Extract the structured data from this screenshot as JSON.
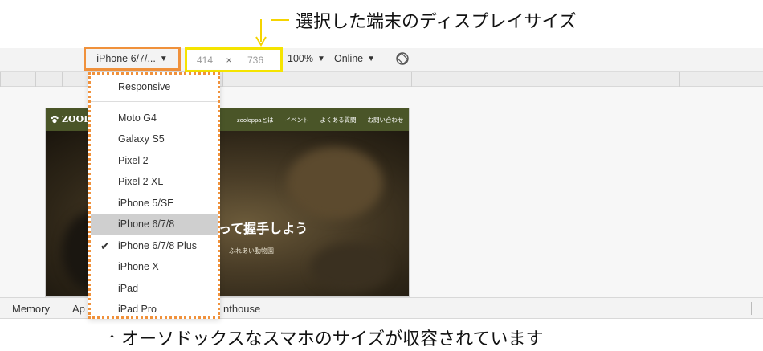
{
  "annotations": {
    "top_text": "選択した端末のディスプレイサイズ",
    "bottom_text": "↑ オーソドックスなスマホのサイズが収容されています"
  },
  "toolbar": {
    "device_label": "iPhone 6/7/...",
    "width_value": "414",
    "times_sign": "×",
    "height_value": "736",
    "zoom_label": "100%",
    "throttle_label": "Online",
    "caret": "▼"
  },
  "menu": {
    "items": [
      {
        "label": "Responsive"
      },
      {
        "label": "Moto G4"
      },
      {
        "label": "Galaxy S5"
      },
      {
        "label": "Pixel 2"
      },
      {
        "label": "Pixel 2 XL"
      },
      {
        "label": "iPhone 5/SE"
      },
      {
        "label": "iPhone 6/7/8"
      },
      {
        "label": "iPhone 6/7/8 Plus"
      },
      {
        "label": "iPhone X"
      },
      {
        "label": "iPad"
      },
      {
        "label": "iPad Pro"
      }
    ],
    "checkmark": "✔"
  },
  "site": {
    "logo_text": "ZOOLO",
    "nav_items": [
      "zooloppaとは",
      "イベント",
      "よくある質問",
      "お問い合わせ"
    ],
    "hero_title": "って握手しよう",
    "hero_sub": "ふれあい動物園"
  },
  "tabs": {
    "items": [
      "Memory",
      "Ap",
      "nthouse"
    ]
  },
  "colors": {
    "device_highlight": "#f0913b",
    "dims_highlight": "#f5e400",
    "site_nav_bg": "#4a5528",
    "selected_item_bg": "#cfcfcf"
  }
}
